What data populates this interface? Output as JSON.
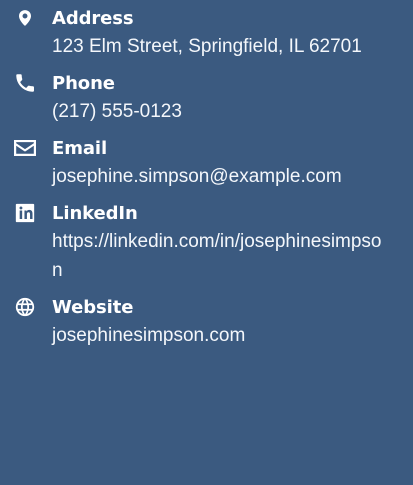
{
  "contact": {
    "items": [
      {
        "id": "address",
        "icon": "location-pin-icon",
        "label": "Address",
        "value": "123 Elm Street, Springfield, IL 62701"
      },
      {
        "id": "phone",
        "icon": "phone-icon",
        "label": "Phone",
        "value": "(217) 555-0123"
      },
      {
        "id": "email",
        "icon": "envelope-icon",
        "label": "Email",
        "value": "josephine.simpson@example.com"
      },
      {
        "id": "linkedin",
        "icon": "linkedin-icon",
        "label": "LinkedIn",
        "value": "https://linkedin.com/in/josephinesimpson"
      },
      {
        "id": "website",
        "icon": "globe-icon",
        "label": "Website",
        "value": "josephinesimpson.com"
      }
    ]
  },
  "colors": {
    "background": "#3b5a80",
    "text": "#ffffff"
  }
}
